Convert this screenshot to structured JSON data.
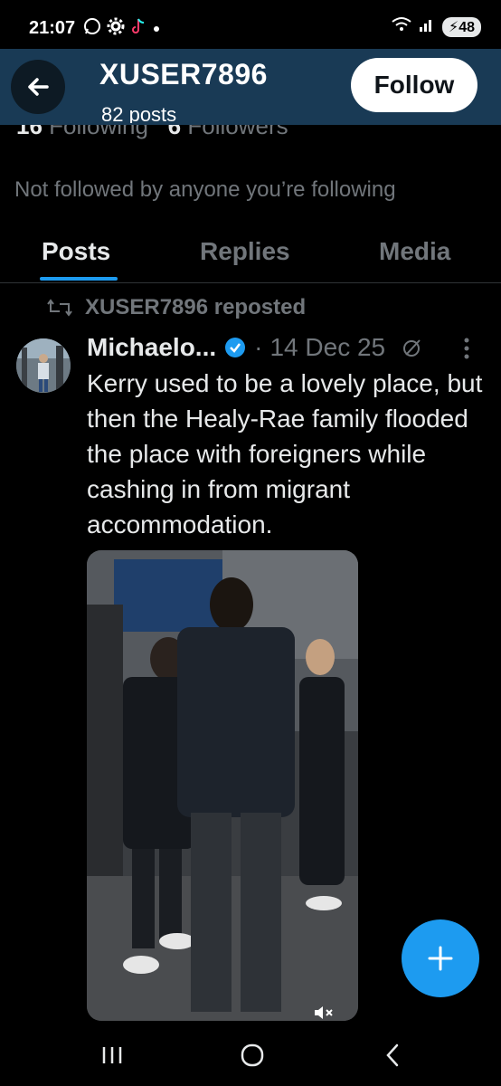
{
  "status_bar": {
    "time": "21:07",
    "battery": "48",
    "icons": [
      "whatsapp-icon",
      "gear-icon",
      "tiktok-icon",
      "dot-icon",
      "wifi-icon",
      "signal-icon"
    ]
  },
  "header": {
    "title": "XUSER7896",
    "subtitle": "82 posts",
    "follow_label": "Follow"
  },
  "profile": {
    "following_count": "16",
    "following_label": " Following",
    "followers_count": "6",
    "followers_label": " Followers",
    "not_followed_text": "Not followed by anyone you’re following"
  },
  "tabs": [
    {
      "label": "Posts",
      "active": true
    },
    {
      "label": "Replies",
      "active": false
    },
    {
      "label": "Media",
      "active": false
    }
  ],
  "post": {
    "repost_text": "XUSER7896 reposted",
    "author": "Michaelo...",
    "separator": "·",
    "date": "14 Dec 25",
    "text": "Kerry used to be a lovely place, but then the Healy-Rae family flooded the place with foreigners while cashing in from migrant accommodation."
  },
  "colors": {
    "accent": "#1d9bf0",
    "header_bg": "#193a55",
    "background": "#000000",
    "muted": "#71767b"
  }
}
